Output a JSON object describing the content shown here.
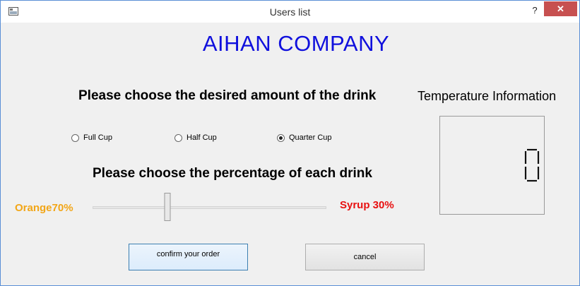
{
  "window": {
    "title": "Users list",
    "help_label": "?",
    "close_label": "✕"
  },
  "company": {
    "name": "AIHAN COMPANY",
    "color": "#1010dd"
  },
  "amount": {
    "heading": "Please choose the desired amount of the drink",
    "options": [
      {
        "label": "Full Cup",
        "selected": false
      },
      {
        "label": "Half Cup",
        "selected": false
      },
      {
        "label": "Quarter Cup",
        "selected": true
      }
    ]
  },
  "mix": {
    "heading": "Please choose the percentage of each drink",
    "orange_label": "Orange70%",
    "syrup_label": "Syrup 30%",
    "slider_fraction": 0.32,
    "orange_color": "#f2a617",
    "syrup_color": "#e81010"
  },
  "temperature": {
    "title": "Temperature Information",
    "value": "0"
  },
  "buttons": {
    "confirm_label": "confirm your order",
    "cancel_label": "cancel"
  }
}
